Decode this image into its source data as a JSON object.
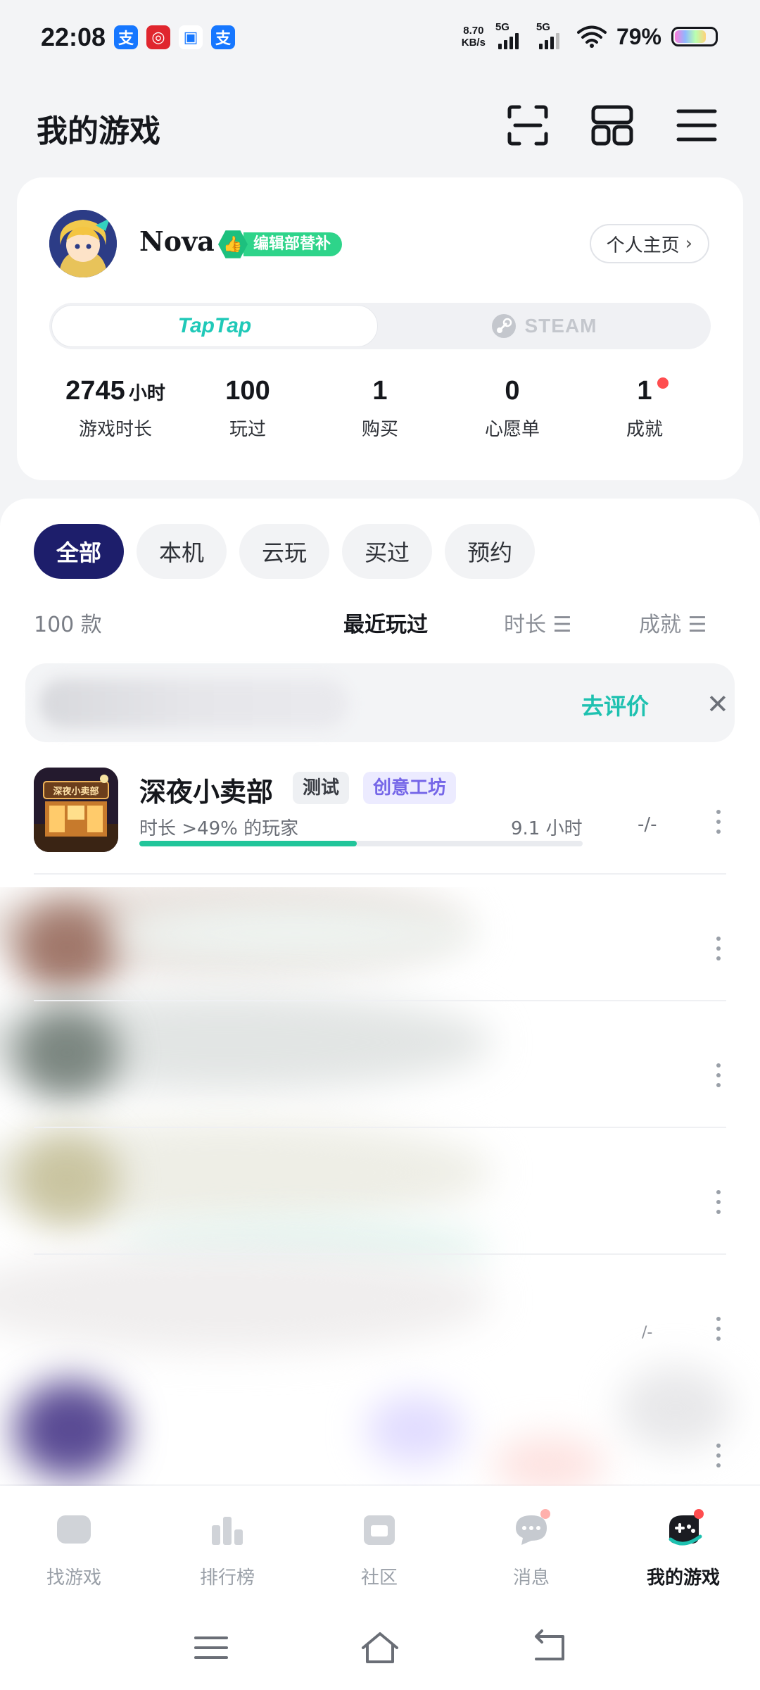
{
  "status_bar": {
    "time": "22:08",
    "notification_icons": [
      {
        "icon": "alipay-icon",
        "glyph": "支",
        "color": "#1677ff"
      },
      {
        "icon": "bank-icon",
        "glyph": "◎",
        "color": "#e0262e"
      },
      {
        "icon": "chat-icon",
        "glyph": "▣",
        "color": "#ffffff"
      },
      {
        "icon": "alipay-icon",
        "glyph": "支",
        "color": "#1677ff"
      }
    ],
    "net_speed_value": "8.70",
    "net_speed_unit": "KB/s",
    "signal_1_label": "5G",
    "signal_2_label": "5G",
    "battery": "79%",
    "battery_level": 0.79
  },
  "header": {
    "title": "我的游戏",
    "icons": [
      "scan-icon",
      "widget-grid-icon",
      "menu-icon"
    ]
  },
  "profile": {
    "username": "Nova",
    "badge_label": "编辑部替补",
    "home_button": "个人主页",
    "platforms": {
      "active": "TapTap",
      "inactive": "STEAM"
    },
    "stats": [
      {
        "value": "2745",
        "unit": "小时",
        "label": "游戏时长"
      },
      {
        "value": "100",
        "unit": "",
        "label": "玩过"
      },
      {
        "value": "1",
        "unit": "",
        "label": "购买"
      },
      {
        "value": "0",
        "unit": "",
        "label": "心愿单"
      },
      {
        "value": "1",
        "unit": "",
        "label": "成就",
        "has_dot": true
      }
    ]
  },
  "filters": [
    "全部",
    "本机",
    "云玩",
    "买过",
    "预约"
  ],
  "active_filter": "全部",
  "list": {
    "count": "100 款",
    "sort_options": [
      {
        "label": "最近玩过",
        "active": true
      },
      {
        "label": "时长 ☰",
        "active": false
      },
      {
        "label": "成就 ☰",
        "active": false
      }
    ]
  },
  "review_prompt": {
    "button": "去评价",
    "close": "✕"
  },
  "games": [
    {
      "name": "深夜小卖部",
      "icon_text": "深夜小卖部",
      "tags": [
        "测试",
        "创意工坊"
      ],
      "rank_text": "时长 >49% 的玩家",
      "hours": "9.1 小时",
      "playtime_percentile": 0.49,
      "achievements": "-/-"
    }
  ],
  "blurred_row_fragment": "/-",
  "tabbar": [
    {
      "label": "找游戏",
      "icon": "find-games-icon",
      "active": false
    },
    {
      "label": "排行榜",
      "icon": "leaderboard-icon",
      "active": false
    },
    {
      "label": "社区",
      "icon": "community-icon",
      "active": false
    },
    {
      "label": "消息",
      "icon": "message-icon",
      "active": false
    },
    {
      "label": "我的游戏",
      "icon": "my-games-icon",
      "active": true
    }
  ],
  "colors": {
    "accent_navy": "#1d1e6b",
    "teal": "#1ec1b0",
    "green_progress": "#21c59a",
    "badge_green": "#2ed48a",
    "workshop_purple": "#7566e8",
    "red_dot": "#ff4d4f"
  }
}
